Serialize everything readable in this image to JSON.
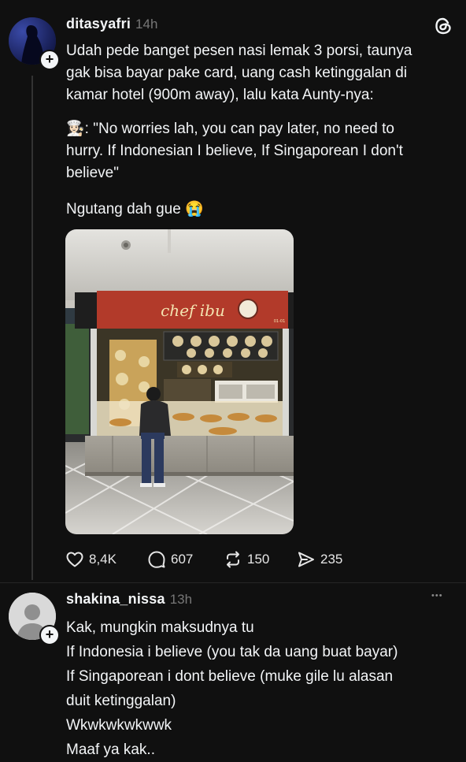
{
  "post": {
    "username": "ditasyafri",
    "time": "14h",
    "add_symbol": "+",
    "lines": [
      "Udah pede banget pesen nasi lemak 3 porsi, taunya",
      "gak bisa bayar pake card, uang cash ketinggalan di",
      "kamar hotel (900m away), lalu kata Aunty-nya:"
    ],
    "quote_emoji": "👩🏻‍🍳",
    "quote_lines": [
      ": \"No worries lah, you can pay later, no need to",
      "hurry. If Indonesian I believe, If Singaporean I don't",
      "believe\""
    ],
    "closing": "Ngutang dah gue",
    "closing_emoji": "😭",
    "photo": {
      "sign_text": "chef ibu",
      "stall_number": "01-01"
    },
    "actions": {
      "likes": "8,4K",
      "comments": "607",
      "reposts": "150",
      "shares": "235"
    }
  },
  "reply": {
    "username": "shakina_nissa",
    "time": "13h",
    "more": "•••",
    "add_symbol": "+",
    "lines": [
      "Kak, mungkin maksudnya tu",
      "If Indonesia i believe (you tak da uang buat bayar)",
      "If Singaporean i dont believe (muke gile lu alasan",
      "duit ketinggalan)",
      "Wkwkwkwkwwk",
      "Maaf ya kak.."
    ]
  },
  "colors": {
    "background": "#101010",
    "text": "#f3f5f7",
    "muted": "#777777",
    "thread_line": "#333333",
    "sign_red": "#b23a2a"
  },
  "icons": [
    "threads-logo-icon",
    "heart-icon",
    "comment-icon",
    "repost-icon",
    "share-icon",
    "more-icon",
    "default-avatar-icon",
    "plus-icon"
  ]
}
